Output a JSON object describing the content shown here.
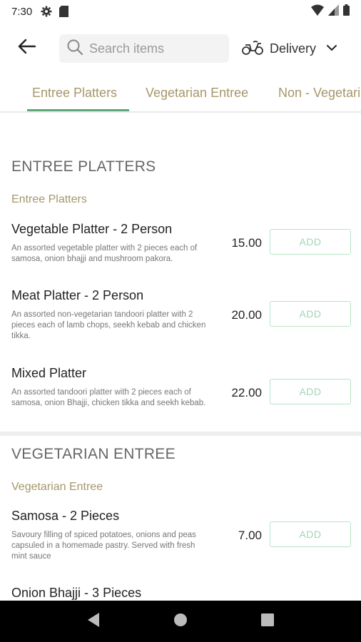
{
  "status_bar": {
    "time": "7:30"
  },
  "header": {
    "search_placeholder": "Search items",
    "delivery_label": "Delivery"
  },
  "tabs": [
    {
      "label": "Entree Platters",
      "active": true
    },
    {
      "label": "Vegetarian Entree",
      "active": false
    },
    {
      "label": "Non - Vegetarian Entree",
      "active": false
    }
  ],
  "sections": [
    {
      "title": "ENTREE PLATTERS",
      "subtitle": "Entree Platters",
      "items": [
        {
          "name": "Vegetable Platter - 2 Person",
          "desc": "An assorted vegetable platter with 2 pieces each of samosa, onion bhajji and mushroom pakora.",
          "price": "15.00",
          "button": "ADD"
        },
        {
          "name": "Meat Platter - 2 Person",
          "desc": "An assorted non-vegetarian tandoori platter with 2 pieces each of lamb chops, seekh kebab and chicken tikka.",
          "price": "20.00",
          "button": "ADD"
        },
        {
          "name": "Mixed Platter",
          "desc": "An assorted tandoori platter with 2 pieces each of samosa, onion Bhajji, chicken tikka and seekh kebab.",
          "price": "22.00",
          "button": "ADD"
        }
      ]
    },
    {
      "title": "VEGETARIAN ENTREE",
      "subtitle": "Vegetarian Entree",
      "items": [
        {
          "name": "Samosa - 2 Pieces",
          "desc": "Savoury filling of spiced potatoes, onions and peas capsuled in a homemade pastry. Served with fresh mint sauce",
          "price": "7.00",
          "button": "ADD"
        },
        {
          "name": "Onion Bhajji - 3 Pieces"
        }
      ]
    }
  ],
  "colors": {
    "accent": "#5ea77a",
    "category": "#a69669",
    "button_border": "#b8e3c8"
  }
}
